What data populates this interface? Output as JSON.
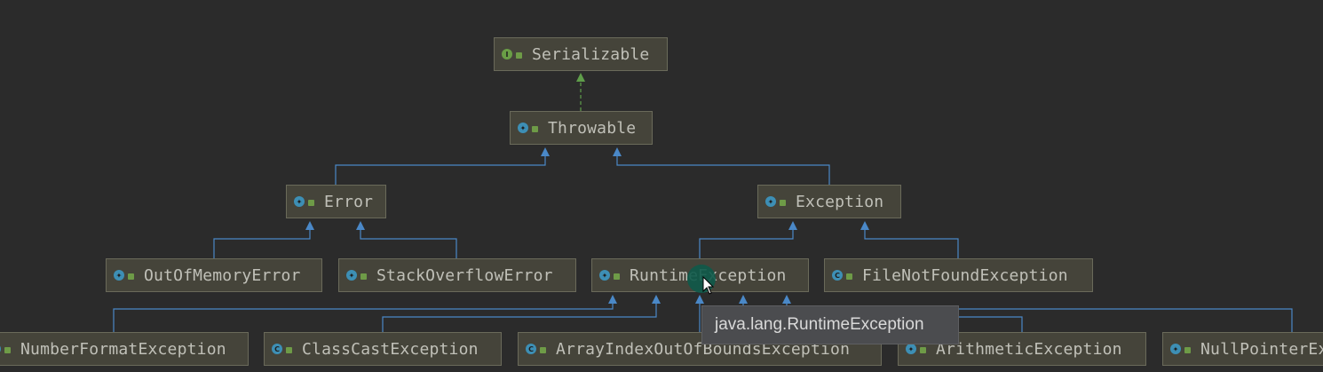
{
  "diagram": {
    "nodes": [
      {
        "id": "serializable",
        "label": "Serializable",
        "kind": "interface"
      },
      {
        "id": "throwable",
        "label": "Throwable",
        "kind": "class"
      },
      {
        "id": "error",
        "label": "Error",
        "kind": "class"
      },
      {
        "id": "exception",
        "label": "Exception",
        "kind": "class"
      },
      {
        "id": "outofmemoryerror",
        "label": "OutOfMemoryError",
        "kind": "class"
      },
      {
        "id": "stackoverflowerror",
        "label": "StackOverflowError",
        "kind": "class"
      },
      {
        "id": "runtimeexception",
        "label": "RuntimeException",
        "kind": "class"
      },
      {
        "id": "filenotfoundexception",
        "label": "FileNotFoundException",
        "kind": "class"
      },
      {
        "id": "numberformatexception",
        "label": "NumberFormatException",
        "kind": "class"
      },
      {
        "id": "classcastexception",
        "label": "ClassCastException",
        "kind": "class"
      },
      {
        "id": "arrayindexoutofboundsexception",
        "label": "ArrayIndexOutOfBoundsException",
        "kind": "class"
      },
      {
        "id": "arithmeticexception",
        "label": "ArithmeticException",
        "kind": "class"
      },
      {
        "id": "nullpointerexception",
        "label": "NullPointerException",
        "kind": "class"
      }
    ],
    "edges": [
      {
        "from": "throwable",
        "to": "serializable",
        "type": "implements"
      },
      {
        "from": "error",
        "to": "throwable",
        "type": "extends"
      },
      {
        "from": "exception",
        "to": "throwable",
        "type": "extends"
      },
      {
        "from": "outofmemoryerror",
        "to": "error",
        "type": "extends"
      },
      {
        "from": "stackoverflowerror",
        "to": "error",
        "type": "extends"
      },
      {
        "from": "runtimeexception",
        "to": "exception",
        "type": "extends"
      },
      {
        "from": "filenotfoundexception",
        "to": "exception",
        "type": "extends"
      },
      {
        "from": "numberformatexception",
        "to": "runtimeexception",
        "type": "extends"
      },
      {
        "from": "classcastexception",
        "to": "runtimeexception",
        "type": "extends"
      },
      {
        "from": "arrayindexoutofboundsexception",
        "to": "runtimeexception",
        "type": "extends"
      },
      {
        "from": "arithmeticexception",
        "to": "runtimeexception",
        "type": "extends"
      },
      {
        "from": "nullpointerexception",
        "to": "runtimeexception",
        "type": "extends"
      }
    ]
  },
  "tooltip": {
    "text": "java.lang.RuntimeException"
  },
  "colors": {
    "background": "#2b2b2b",
    "node_fill": "#45443a",
    "node_border": "#6a6a5a",
    "extends_edge": "#4a88c7",
    "implements_edge": "#5f9e4a",
    "text": "#c0c0b8"
  },
  "icons": {
    "interface": "interface-icon",
    "class": "class-icon",
    "access": "public-access-icon"
  }
}
